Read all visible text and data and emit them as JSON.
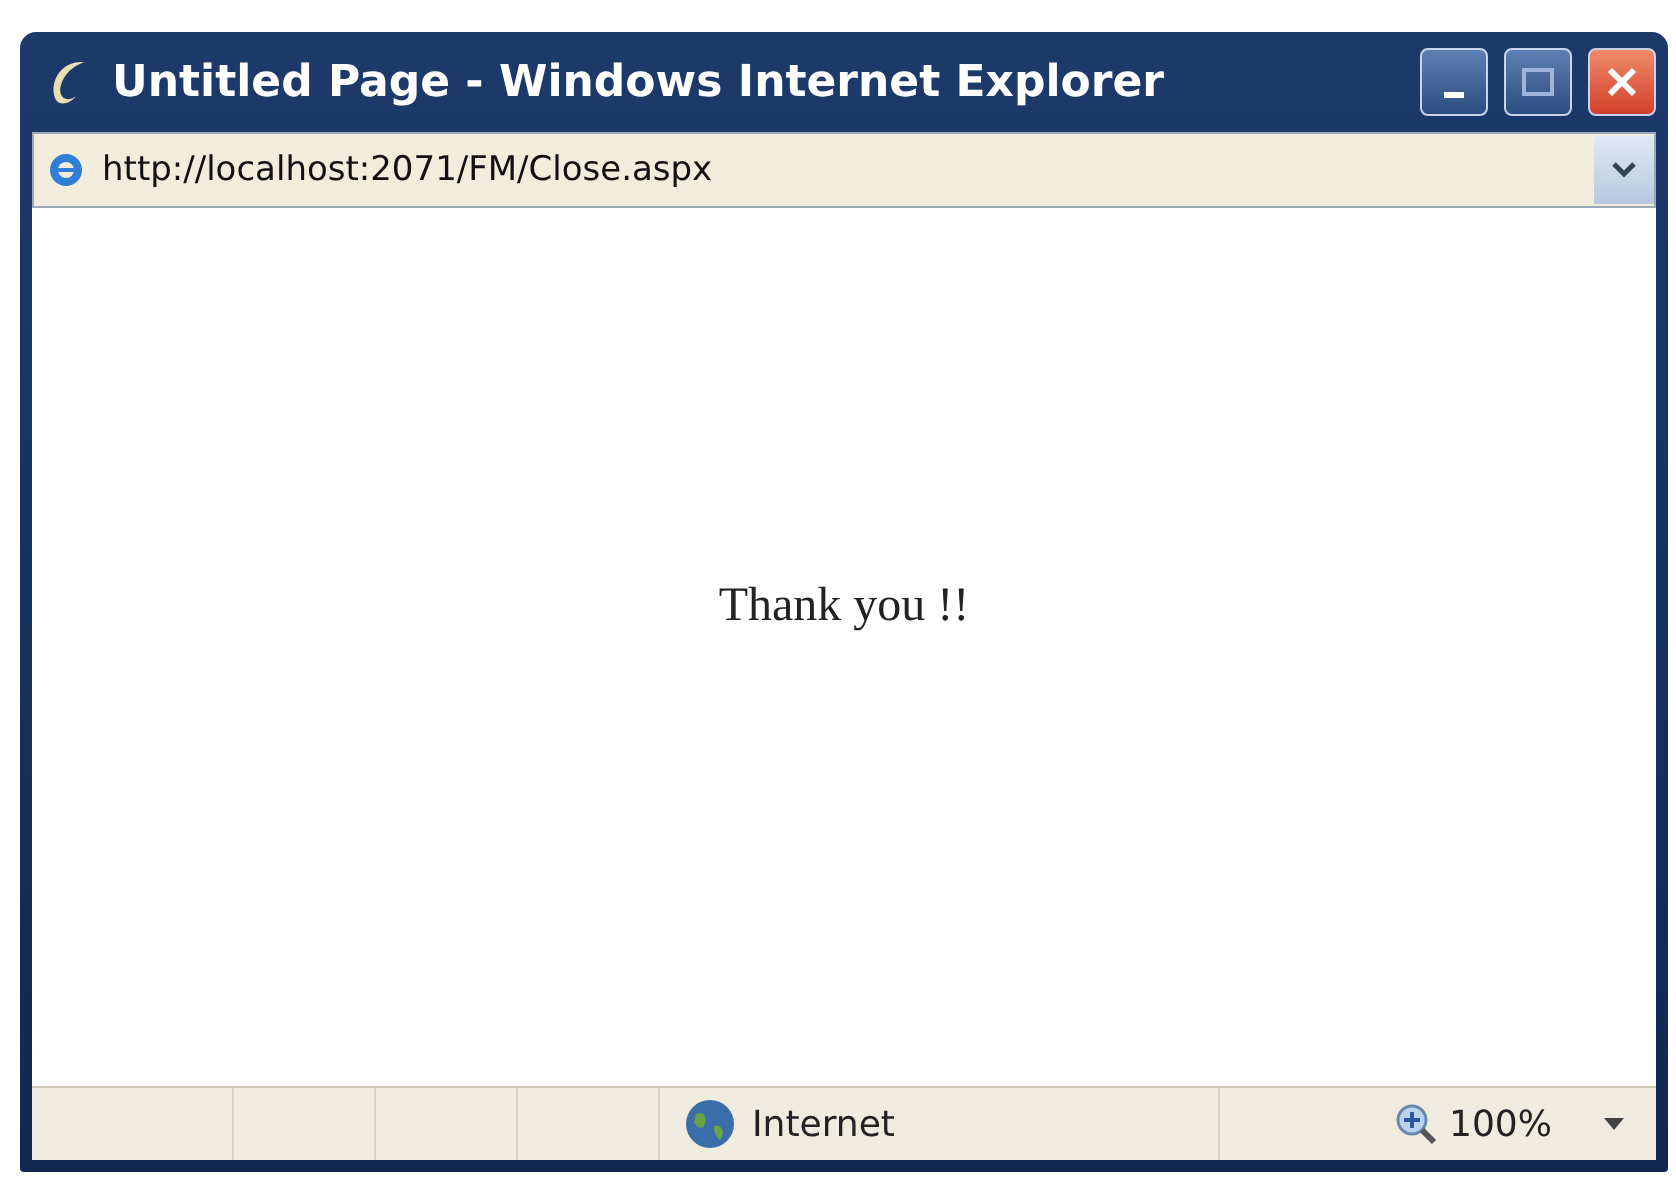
{
  "window": {
    "title": "Untitled Page - Windows Internet Explorer"
  },
  "address_bar": {
    "url": "http://localhost:2071/FM/Close.aspx"
  },
  "page": {
    "message": "Thank you !!"
  },
  "status_bar": {
    "zone": "Internet",
    "zoom": "100%"
  }
}
